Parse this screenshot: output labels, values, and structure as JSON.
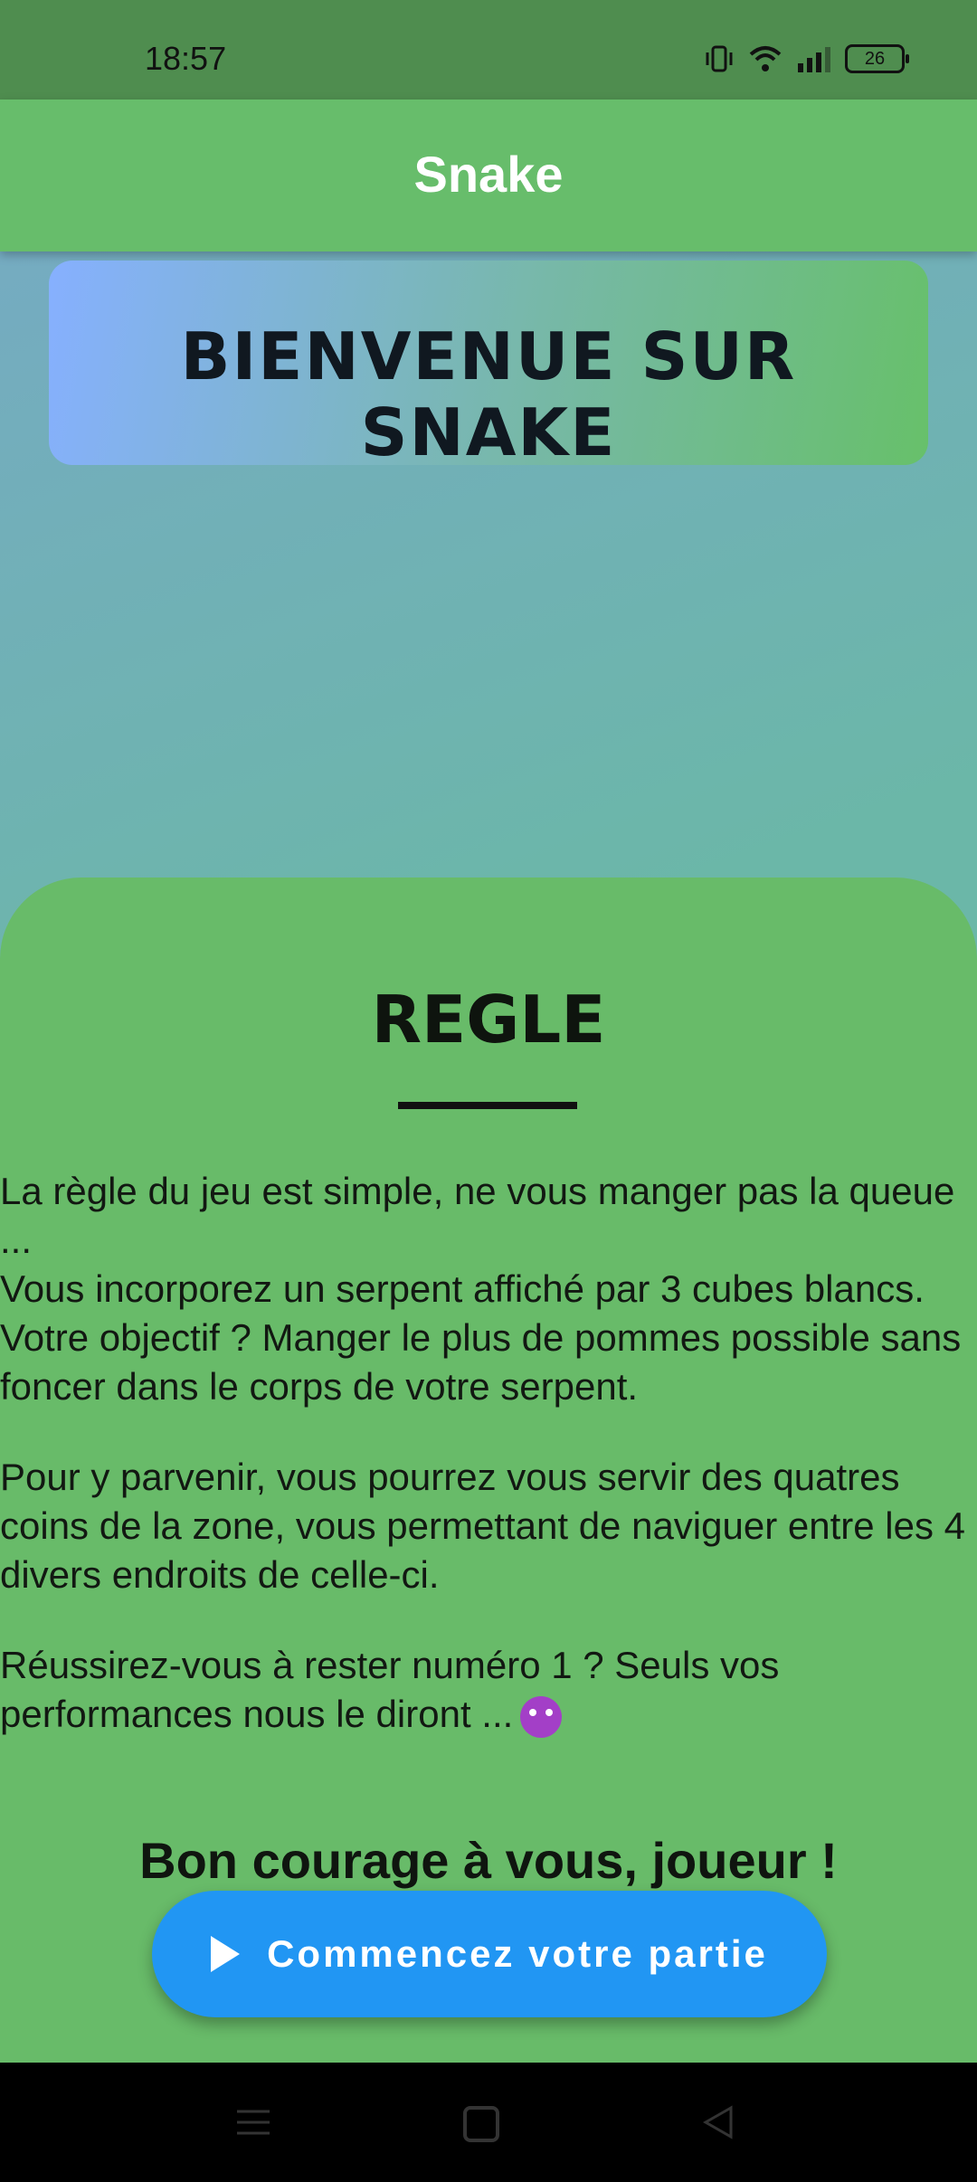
{
  "status_bar": {
    "time": "18:57",
    "battery": "26",
    "icons": [
      "vibrate-icon",
      "wifi-icon",
      "signal-icon",
      "battery-icon"
    ]
  },
  "app_bar": {
    "title": "Snake"
  },
  "welcome": {
    "text": "BIENVENUE SUR SNAKE"
  },
  "rules": {
    "title": "REGLE",
    "paragraphs": [
      "La règle du jeu est simple, ne vous manger pas la queue ...\nVous incorporez un serpent affiché par 3 cubes blancs. Votre objectif ? Manger le plus de pommes possible sans foncer dans le corps de votre serpent.",
      "Pour y parvenir, vous pourrez vous servir des quatres coins de la zone, vous permettant de naviguer entre les 4 divers endroits de celle-ci.",
      "Réussirez-vous à rester numéro 1 ? Seuls vos performances nous le diront ..."
    ],
    "good_luck": "Bon courage à vous, joueur !"
  },
  "start_button": {
    "label": "Commencez votre partie",
    "icon": "play-icon"
  },
  "colors": {
    "status_bar": "#4f8d4f",
    "app_bar": "#67bd6b",
    "panel": "#68bb69",
    "button": "#2196f3"
  }
}
